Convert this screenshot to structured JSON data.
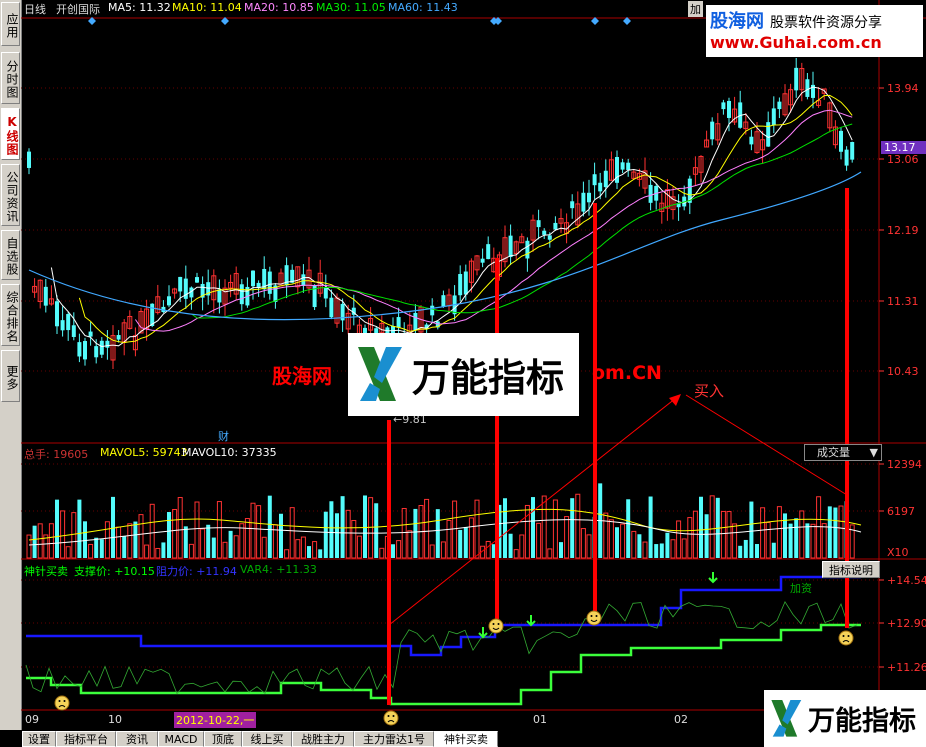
{
  "sidebar": {
    "tabs": [
      "应用",
      "分时图",
      "K线图",
      "公司资讯",
      "自选股",
      "综合排名",
      "更多"
    ]
  },
  "header": {
    "period": "日线",
    "stock_name": "开创国际",
    "ma5": "MA5: 11.32",
    "ma10": "MA10: 11.04",
    "ma20": "MA20: 10.85",
    "ma30": "MA30: 11.05",
    "ma60": "MA60: 11.43",
    "right_clip": "加"
  },
  "price_axis": {
    "ticks": [
      "13.94",
      "13.06",
      "12.19",
      "11.31",
      "10.43"
    ],
    "current": "13.17",
    "low_marker": "←9.81",
    "cai_marker": "财"
  },
  "volume": {
    "label": "总手: 19605",
    "mavol5": "MAVOL5: 59743",
    "mavol10": "MAVOL10: 37335",
    "dropdown": "成交量",
    "ticks": [
      "12394",
      "6197"
    ],
    "unit": "X10"
  },
  "indicator": {
    "name": "神针买卖",
    "support": "支撑价: +10.15",
    "resist": "阻力价: +11.94",
    "var4": "VAR4: +11.33",
    "help_button": "指标说明",
    "ticks": [
      "+14.54",
      "+12.90",
      "+11.26"
    ],
    "annotation": "加资"
  },
  "date_axis": {
    "labels": [
      "09",
      "10",
      "01",
      "02"
    ],
    "cursor_date": "2012-10-22,一"
  },
  "annotations": {
    "buy": "买入"
  },
  "watermarks": {
    "top_logo": "股海网",
    "top_slogan": "股票软件资源分享",
    "top_url": "www.Guhai.com.cn",
    "center_brand": "万能指标",
    "center_left": "股海网",
    "center_right": "om.CN",
    "bottom_brand": "万能指标"
  },
  "bottom_tabs": [
    "设置",
    "指标平台",
    "资讯",
    "MACD",
    "顶底",
    "线上买",
    "战胜主力",
    "主力雷达1号",
    "神针买卖"
  ],
  "colors": {
    "up": "#ff3232",
    "down": "#54fcfc",
    "ma5": "#ffffff",
    "ma10": "#ffff00",
    "ma20": "#ff80ff",
    "ma30": "#00e000",
    "ma60": "#40a8ff",
    "support": "#3cff3c",
    "resist": "#1818ff"
  }
}
